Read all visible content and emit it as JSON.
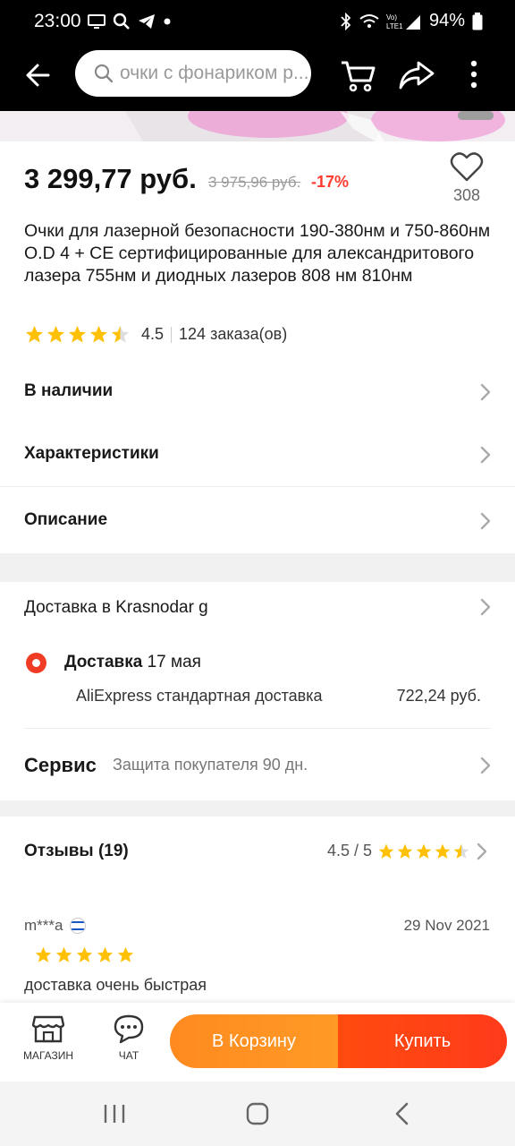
{
  "status_bar": {
    "time": "23:00",
    "battery": "94%"
  },
  "toolbar": {
    "search_placeholder": "очки с фонариком р..."
  },
  "product": {
    "price": "3 299,77 руб.",
    "old_price": "3 975,96 руб.",
    "discount": "-17%",
    "likes": "308",
    "title": "Очки для лазерной безопасности 190-380нм и 750-860нм O.D 4 + CE сертифицированные для александритового лазера 755нм и диодных лазеров 808 нм 810нм",
    "rating": "4.5",
    "orders": "124 заказа(ов)"
  },
  "rows": {
    "in_stock": "В наличии",
    "specs": "Характеристики",
    "description": "Описание"
  },
  "delivery": {
    "title": "Доставка в Krasnodar g",
    "type_label": "Доставка",
    "date": "17 мая",
    "method": "AliExpress стандартная доставка",
    "price": "722,24 руб."
  },
  "service": {
    "label": "Сервис",
    "value": "Защита покупателя 90 дн."
  },
  "reviews": {
    "label": "Отзывы (19)",
    "score": "4.5 / 5",
    "first": {
      "user": "m***a",
      "date": "29 Nov 2021",
      "text": "доставка очень быстрая"
    }
  },
  "action_bar": {
    "store": "МАГАЗИН",
    "chat": "ЧАТ",
    "cart": "В Корзину",
    "buy": "Купить"
  },
  "colors": {
    "accent": "#ff3b30",
    "star": "#ffc107",
    "cart": "#ff8a1f",
    "buy": "#ff4b0f"
  }
}
